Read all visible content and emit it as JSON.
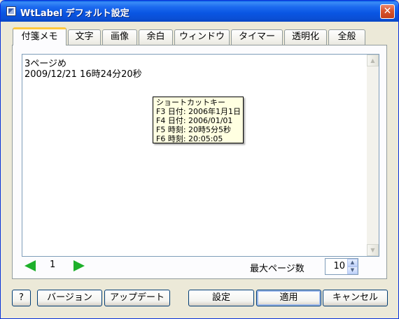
{
  "window": {
    "title": "WtLabel デフォルト設定",
    "close_glyph": "✕"
  },
  "tabs": [
    {
      "label": "付箋メモ",
      "active": true
    },
    {
      "label": "文字"
    },
    {
      "label": "画像"
    },
    {
      "label": "余白"
    },
    {
      "label": "ウィンドウ"
    },
    {
      "label": "タイマー"
    },
    {
      "label": "透明化"
    },
    {
      "label": "全般"
    }
  ],
  "memo": {
    "lines": [
      "3ページめ",
      "2009/12/21 16時24分20秒"
    ]
  },
  "tooltip": {
    "title": "ショートカットキー",
    "lines": [
      "F3 日付: 2006年1月1日",
      "F4 日付: 2006/01/01",
      "F5 時刻: 20時5分5秒",
      "F6 時刻: 20:05:05"
    ]
  },
  "paging": {
    "current_page": "1",
    "max_page_label": "最大ページ数",
    "max_page_value": "10"
  },
  "buttons": {
    "help": "?",
    "version": "バージョン",
    "update": "アップデート",
    "settings": "設定",
    "apply": "適用",
    "cancel": "キャンセル"
  },
  "colors": {
    "titlebar": "#0A5FE6",
    "window_bg": "#ECE9D8",
    "active_tab_accent": "#FFC83C",
    "tooltip_bg": "#FFFFE1",
    "arrow": "#1DB02A"
  }
}
